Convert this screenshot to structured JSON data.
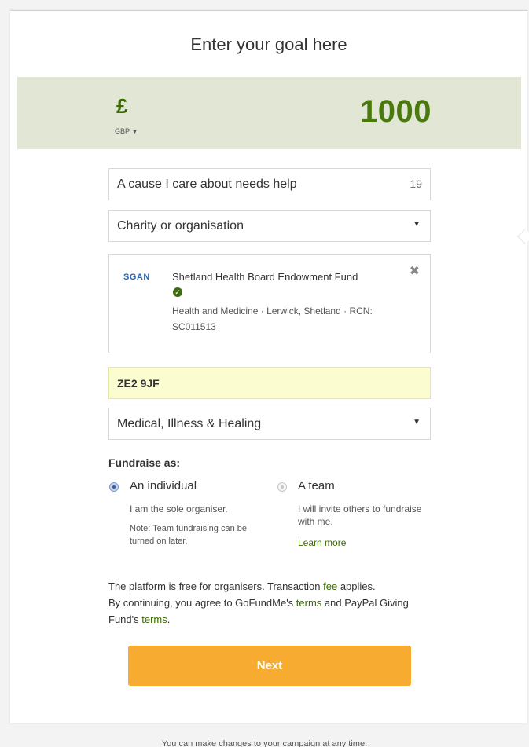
{
  "header": {
    "title": "Enter your goal here"
  },
  "goal": {
    "currency_symbol": "£",
    "currency_code": "GBP",
    "amount": "1000"
  },
  "form": {
    "title_field": {
      "value": "A cause I care about needs help",
      "counter": "19"
    },
    "beneficiary_select": {
      "value": "Charity or organisation"
    },
    "charity": {
      "logo_text": "SGAN",
      "name": "Shetland Health Board Endowment Fund",
      "meta_line1": "Health and Medicine · Lerwick, Shetland · RCN:",
      "meta_line2": "SC011513",
      "remove_icon": "close-icon"
    },
    "postcode": {
      "value": "ZE2 9JF"
    },
    "category_select": {
      "value": "Medical, Illness & Healing"
    }
  },
  "fundraise_as": {
    "label": "Fundraise as:",
    "options": [
      {
        "label": "An individual",
        "desc": "I am the sole organiser.",
        "note": "Note: Team fundraising can be turned on later.",
        "selected": true
      },
      {
        "label": "A team",
        "desc": "I will invite others to fundraise with me.",
        "link": "Learn more",
        "selected": false
      }
    ]
  },
  "legal": {
    "line1_pre": "The platform is free for organisers. Transaction ",
    "fee_link": "fee",
    "line1_post": " applies.",
    "line2_pre": "By continuing, you agree to GoFundMe's ",
    "terms_link_1": "terms",
    "line2_mid": " and PayPal Giving Fund's ",
    "terms_link_2": "terms",
    "line2_post": "."
  },
  "actions": {
    "next_label": "Next"
  },
  "footer": {
    "note": "You can make changes to your campaign at any time."
  },
  "colors": {
    "accent_green": "#4a7a0c",
    "goal_band": "#e2e7d5",
    "next_button": "#f7ac31",
    "postcode_highlight": "#fbfccf"
  }
}
